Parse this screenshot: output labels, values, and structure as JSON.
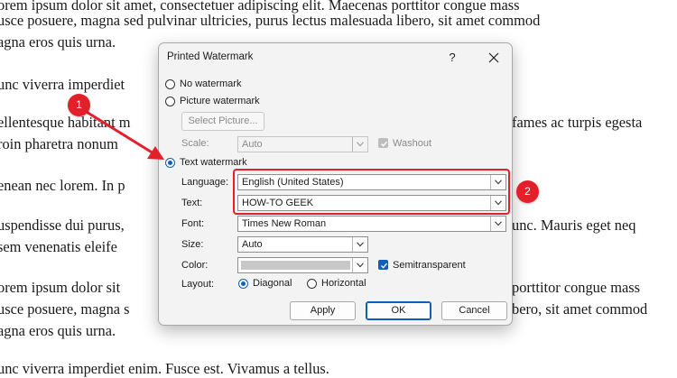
{
  "document": {
    "lines": [
      "orem ipsum dolor sit amet, consectetuer adipiscing elit. Maecenas porttitor congue mass",
      "usce posuere, magna sed pulvinar ultricies, purus lectus malesuada libero, sit amet commod",
      "agna eros quis urna.",
      "unc viverra imperdiet",
      "ellentesque habitant m",
      "fames ac turpis egesta",
      "roin pharetra nonum",
      "enean nec lorem. In p",
      "uspendisse dui purus,",
      "unc. Mauris eget neq",
      " sem venenatis eleife",
      "orem ipsum dolor sit",
      "porttitor congue mass",
      "usce posuere, magna s",
      "bero, sit amet commod",
      "agna eros quis urna.",
      "unc viverra imperdiet enim. Fusce est. Vivamus a tellus."
    ]
  },
  "dialog": {
    "title": "Printed Watermark",
    "help_label": "?",
    "no_watermark_label": "No watermark",
    "picture_watermark_label": "Picture watermark",
    "select_picture_label": "Select Picture...",
    "scale_label": "Scale:",
    "scale_value": "Auto",
    "washout_label": "Washout",
    "text_watermark_label": "Text watermark",
    "language_label": "Language:",
    "language_value": "English (United States)",
    "text_label": "Text:",
    "text_value": "HOW-TO GEEK",
    "font_label": "Font:",
    "font_value": "Times New Roman",
    "size_label": "Size:",
    "size_value": "Auto",
    "color_label": "Color:",
    "semitransparent_label": "Semitransparent",
    "layout_label": "Layout:",
    "diagonal_label": "Diagonal",
    "horizontal_label": "Horizontal",
    "apply_label": "Apply",
    "ok_label": "OK",
    "cancel_label": "Cancel"
  },
  "annotations": {
    "badge_1": "1",
    "badge_2": "2"
  },
  "colors": {
    "accent": "#0f5fb8",
    "annotation_red": "#e3202a",
    "dialog_bg": "#f3f3f3"
  }
}
